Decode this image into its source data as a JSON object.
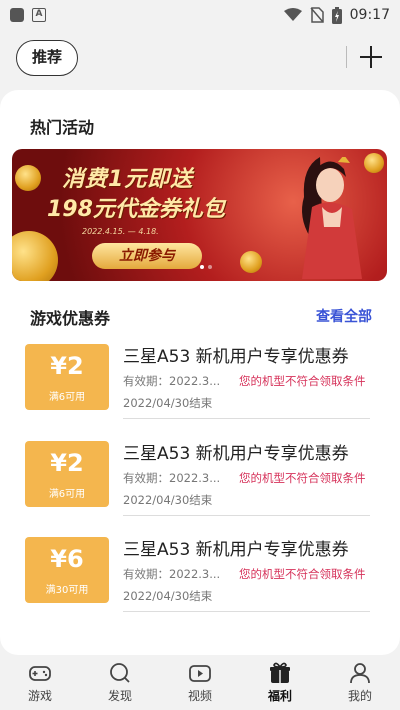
{
  "status_bar": {
    "time": "09:17",
    "icons": [
      "app-square-icon",
      "a-badge-icon",
      "wifi-icon",
      "no-sim-icon",
      "battery-charging-icon"
    ]
  },
  "top_bar": {
    "tab_label": "推荐",
    "add_icon": "plus-icon"
  },
  "hot_events": {
    "title": "热门活动",
    "banner": {
      "line1": "消费1元即送",
      "line2": "198元代金券礼包",
      "date": "2022.4.15. — 4.18.",
      "button": "立即参与",
      "slide_count": 2,
      "active_slide": 0
    }
  },
  "coupons": {
    "title": "游戏优惠券",
    "see_all": "查看全部",
    "items": [
      {
        "value": "¥2",
        "condition": "满6可用",
        "title": "三星A53 新机用户专享优惠券",
        "valid": "有效期：2022.3...",
        "warning": "您的机型不符合领取条件",
        "end": "2022/04/30结束"
      },
      {
        "value": "¥2",
        "condition": "满6可用",
        "title": "三星A53 新机用户专享优惠券",
        "valid": "有效期：2022.3...",
        "warning": "您的机型不符合领取条件",
        "end": "2022/04/30结束"
      },
      {
        "value": "¥6",
        "condition": "满30可用",
        "title": "三星A53 新机用户专享优惠券",
        "valid": "有效期：2022.3...",
        "warning": "您的机型不符合领取条件",
        "end": "2022/04/30结束"
      }
    ]
  },
  "bottom_nav": {
    "active_index": 3,
    "items": [
      {
        "label": "游戏",
        "icon": "gamepad-icon"
      },
      {
        "label": "发现",
        "icon": "search-icon"
      },
      {
        "label": "视频",
        "icon": "video-icon"
      },
      {
        "label": "福利",
        "icon": "gift-icon"
      },
      {
        "label": "我的",
        "icon": "profile-icon"
      }
    ]
  },
  "colors": {
    "coupon": "#f4b64e",
    "link": "#3a54d6",
    "warning": "#d6325a"
  }
}
